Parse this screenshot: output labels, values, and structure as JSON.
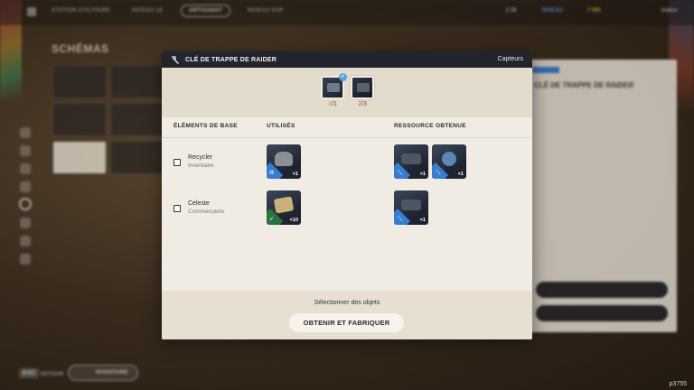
{
  "background": {
    "topbar": {
      "tabs": [
        "STATION UTILITAIRE",
        "NIVEAU 18",
        "ARTISANAT",
        "NIVEAU SUP"
      ],
      "active_tab": "ARTISANAT",
      "resources": [
        "2 35",
        "NIVEAU",
        "7 991",
        "Indice"
      ]
    },
    "schemas_title": "SCHÉMAS",
    "right_panel_title": "CLÉ DE TRAPPE DE RAIDER",
    "bottom": {
      "esc_key": "ESC",
      "back_label": "RETOUR",
      "inventory_label": "INVENTAIRE"
    }
  },
  "modal": {
    "title": "CLÉ DE TRAPPE DE RAIDER",
    "subtitle": "Capteurs",
    "selectors": [
      {
        "have": "3",
        "need": "/1",
        "checked": true
      },
      {
        "have": "2",
        "need": "/3",
        "checked": false
      }
    ],
    "columns": {
      "base": "ÉLÉMENTS DE BASE",
      "used": "UTILISÉS",
      "obtained": "RESSOURCE OBTENUE"
    },
    "rows": [
      {
        "name": "Recycler",
        "source": "Inventaire",
        "used": [
          {
            "qty": "×1",
            "icon": "recycle-icon"
          }
        ],
        "obtained": [
          {
            "qty": "×1",
            "icon": "wrench-icon"
          },
          {
            "qty": "×1",
            "icon": "wrench-icon"
          }
        ]
      },
      {
        "name": "Celeste",
        "source": "Commerçants",
        "used": [
          {
            "qty": "×10",
            "icon": "bird-icon"
          }
        ],
        "obtained": [
          {
            "qty": "×1",
            "icon": "wrench-icon"
          }
        ]
      }
    ],
    "footer": {
      "select_label": "Sélectionner des objets",
      "button_label": "OBTENIR ET FABRIQUER"
    }
  },
  "watermark": "p3755",
  "colors": {
    "accent_blue": "#3a86e0",
    "header_dark": "#23252d",
    "modal_bg": "#f1ece3",
    "count_ok": "#d7a21e",
    "count_missing": "#d44b3a"
  }
}
